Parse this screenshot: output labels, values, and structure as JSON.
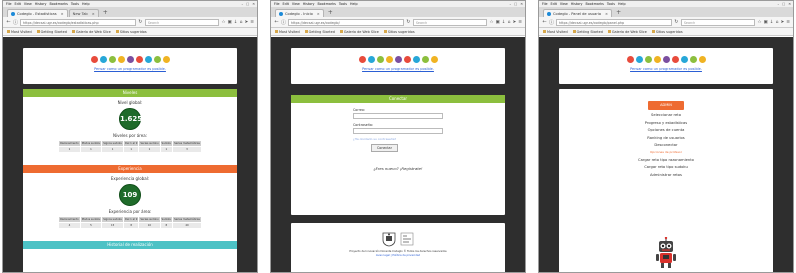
{
  "browser": {
    "menu": [
      "File",
      "Edit",
      "View",
      "History",
      "Bookmarks",
      "Tools",
      "Help"
    ],
    "new_tab_label": "New Tab",
    "search_placeholder": "Search",
    "bookmarks": [
      "Most Visited",
      "Getting Started",
      "Galería de Web Slice",
      "Sitios sugeridos"
    ],
    "window_controls": [
      "–",
      "□",
      "✕"
    ]
  },
  "windows": [
    {
      "tab_title": "Codeglo - Estadísticas",
      "url": "https://decsai.ugr.es/codeglo/estadisticas.php",
      "page": "stats"
    },
    {
      "tab_title": "Codeglo - Inicio",
      "url": "https://decsai.ugr.es/codeglo/",
      "page": "login"
    },
    {
      "tab_title": "Codeglo - Panel de usuario",
      "url": "https://decsai.ugr.es/codeglo/panel.php",
      "page": "panel"
    }
  ],
  "site": {
    "logo_link": "Pensar como un programador es posible.",
    "logo_colors": [
      "#e84b3c",
      "#27a7d8",
      "#8cbf3e",
      "#f0b323",
      "#7b4fa0",
      "#e84b3c",
      "#27a7d8",
      "#8cbf3e",
      "#f0b323"
    ]
  },
  "stats_page": {
    "levels_header": "Niveles",
    "global_level_label": "Nivel global:",
    "global_level_value": "1.625",
    "levels_by_area_label": "Niveles por área:",
    "area_columns": [
      "Razonamiento",
      "Modos sudoku",
      "Signos sudoku",
      "Del 1 al 9",
      "Series sudoku",
      "Sudoku",
      "Series matemáticas"
    ],
    "level_values": [
      "1",
      "1",
      "1",
      "1",
      "1",
      "1",
      "3"
    ],
    "experience_header": "Experiencia",
    "global_exp_label": "Experiencia global:",
    "global_exp_value": "109",
    "exp_by_area_label": "Experiencia por área:",
    "exp_values": [
      "4",
      "5",
      "15",
      "8",
      "10",
      "8",
      "40"
    ],
    "history_header": "Historial de realización"
  },
  "login_page": {
    "header": "Conectar",
    "email_label": "Correo:",
    "password_label": "Contraseña:",
    "forgot_link": "¿Ha olvidado su contraseña?",
    "submit_label": "Conectar",
    "register_text": "¿Eres nuevo? ¡Regístrate!",
    "footer_text": "Proyecto de Innovación Docente Codeglo © Todos los derechos reservados",
    "footer_link": "Aviso legal | Política de privacidad"
  },
  "panel_page": {
    "admin_label": "ADMIN",
    "menu": [
      "Seleccionar reto",
      "Progreso y estadísticas",
      "Opciones de cuenta",
      "Ranking de usuarios",
      "Desconectar"
    ],
    "profesor_label": "Opciones de profesor",
    "prof_menu": [
      "Cargar reto tipo razonamiento",
      "Cargar reto tipo sudoku",
      "Administrar retos"
    ]
  }
}
